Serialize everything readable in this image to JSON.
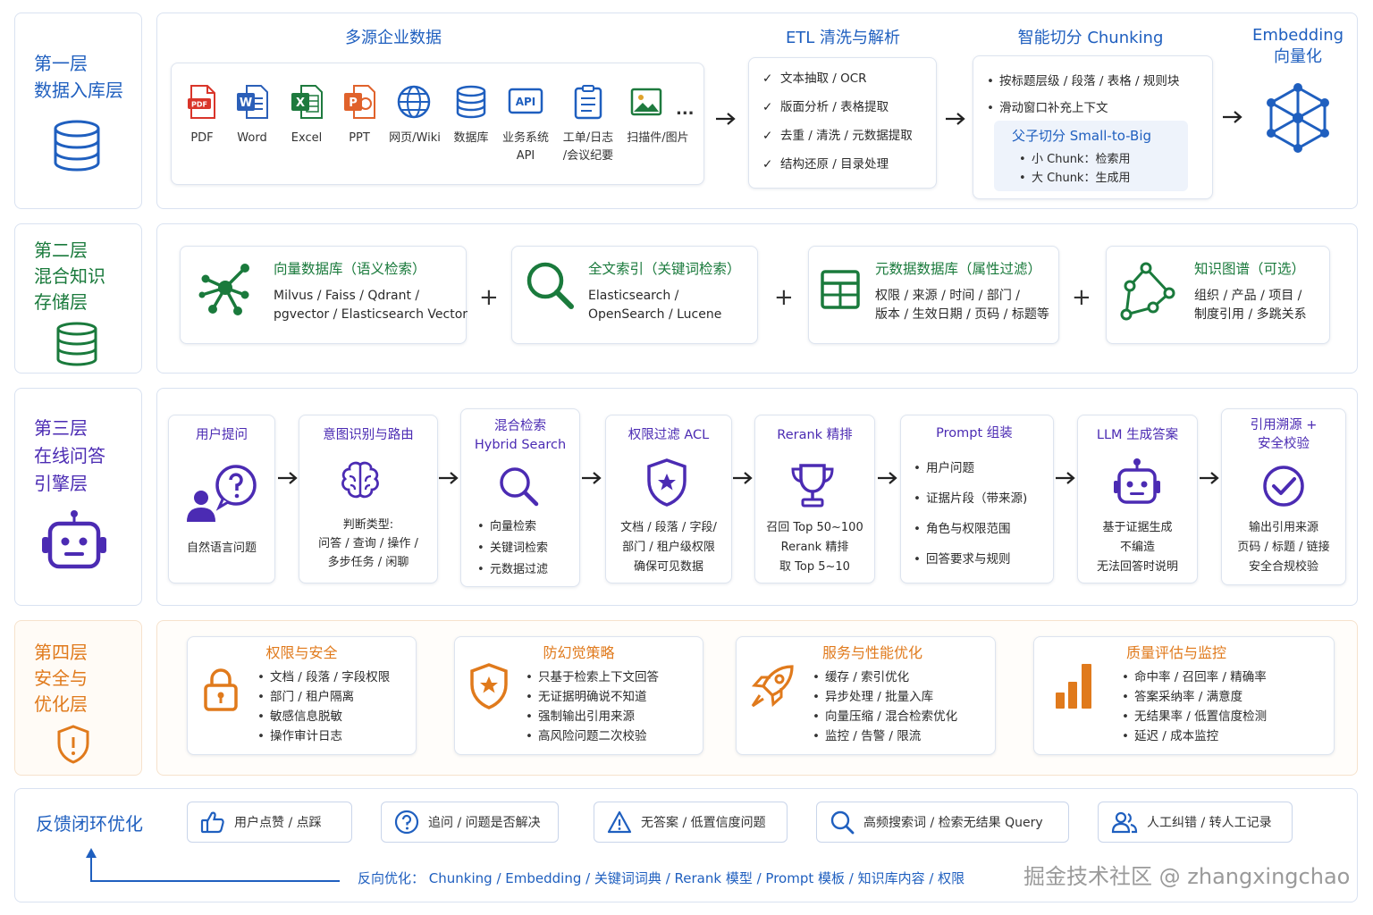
{
  "layer1": {
    "title_line1": "第一层",
    "title_line2": "数据入库层",
    "sources_header": "多源企业数据",
    "sources": [
      {
        "label": "PDF",
        "icon": "pdf-file-icon"
      },
      {
        "label": "Word",
        "icon": "word-file-icon"
      },
      {
        "label": "Excel",
        "icon": "excel-file-icon"
      },
      {
        "label": "PPT",
        "icon": "ppt-file-icon"
      },
      {
        "label": "网页/Wiki",
        "icon": "globe-icon"
      },
      {
        "label": "数据库",
        "icon": "database-icon"
      },
      {
        "label_line1": "业务系统",
        "label_line2": "API",
        "icon": "api-icon"
      },
      {
        "label_line1": "工单/日志",
        "label_line2": "/会议纪要",
        "icon": "clipboard-icon"
      },
      {
        "label": "扫描件/图片",
        "icon": "image-icon"
      }
    ],
    "ellipsis": "...",
    "etl_header": "ETL 清洗与解析",
    "etl_items": [
      "文本抽取 / OCR",
      "版面分析 / 表格提取",
      "去重 / 清洗 / 元数据提取",
      "结构还原 / 目录处理"
    ],
    "chunk_header": "智能切分 Chunking",
    "chunk_items": [
      "按标题层级 / 段落 / 表格 / 规则块",
      "滑动窗口补充上下文"
    ],
    "chunk_sub_header": "父子切分 Small-to-Big",
    "chunk_sub_items": [
      "小 Chunk：检索用",
      "大 Chunk：生成用"
    ],
    "embed_header_line1": "Embedding",
    "embed_header_line2": "向量化"
  },
  "layer2": {
    "title_line1": "第二层",
    "title_line2": "混合知识",
    "title_line3": "存储层",
    "stores": [
      {
        "title": "向量数据库（语义检索）",
        "line1": "Milvus / Faiss / Qdrant /",
        "line2": "pgvector / Elasticsearch Vector"
      },
      {
        "title": "全文索引（关键词检索）",
        "line1": "Elasticsearch /",
        "line2": "OpenSearch / Lucene"
      },
      {
        "title": "元数据数据库（属性过滤）",
        "line1": "权限 / 来源 / 时间 / 部门 /",
        "line2": "版本 / 生效日期 / 页码 / 标题等"
      },
      {
        "title": "知识图谱（可选）",
        "line1": "组织 / 产品 / 项目 /",
        "line2": "制度引用 / 多跳关系"
      }
    ],
    "plus": "+"
  },
  "layer3": {
    "title_line1": "第三层",
    "title_line2": "在线问答",
    "title_line3": "引擎层",
    "steps": [
      {
        "title": "用户提问",
        "body": [
          "自然语言问题"
        ]
      },
      {
        "title": "意图识别与路由",
        "body": [
          "判断类型:",
          "问答 / 查询 / 操作 /",
          "多步任务 / 闲聊"
        ]
      },
      {
        "title_line1": "混合检索",
        "title_line2": "Hybrid Search",
        "bullets": [
          "向量检索",
          "关键词检索",
          "元数据过滤"
        ]
      },
      {
        "title": "权限过滤 ACL",
        "body": [
          "文档 / 段落 / 字段/",
          "部门 / 租户级权限",
          "确保可见数据"
        ]
      },
      {
        "title": "Rerank 精排",
        "body": [
          "召回 Top 50~100",
          "Rerank 精排",
          "取 Top 5~10"
        ]
      },
      {
        "title": "Prompt 组装",
        "bullets": [
          "用户问题",
          "证据片段（带来源)",
          "角色与权限范围",
          "回答要求与规则"
        ]
      },
      {
        "title": "LLM 生成答案",
        "body": [
          "基于证据生成",
          "不编造",
          "无法回答时说明"
        ]
      },
      {
        "title_line1": "引用溯源 +",
        "title_line2": "安全校验",
        "body": [
          "输出引用来源",
          "页码 / 标题 / 链接",
          "安全合规校验"
        ]
      }
    ]
  },
  "layer4": {
    "title_line1": "第四层",
    "title_line2": "安全与",
    "title_line3": "优化层",
    "groups": [
      {
        "title": "权限与安全",
        "items": [
          "文档 / 段落 / 字段权限",
          "部门 / 租户隔离",
          "敏感信息脱敏",
          "操作审计日志"
        ]
      },
      {
        "title": "防幻觉策略",
        "items": [
          "只基于检索上下文回答",
          "无证据明确说不知道",
          "强制输出引用来源",
          "高风险问题二次校验"
        ]
      },
      {
        "title": "服务与性能优化",
        "items": [
          "缓存 / 索引优化",
          "异步处理 / 批量入库",
          "向量压缩 / 混合检索优化",
          "监控 / 告警 / 限流"
        ]
      },
      {
        "title": "质量评估与监控",
        "items": [
          "命中率 / 召回率 / 精确率",
          "答案采纳率 / 满意度",
          "无结果率 / 低置信度检测",
          "延迟 / 成本监控"
        ]
      }
    ]
  },
  "feedback": {
    "title": "反馈闭环优化",
    "chips": [
      "用户点赞 / 点踩",
      "追问 / 问题是否解决",
      "无答案 / 低置信度问题",
      "高频搜索词 / 检索无结果 Query",
      "人工纠错 / 转人工记录"
    ],
    "reverse_label": "反向优化：",
    "reverse_items": "Chunking / Embedding / 关键词词典 / Rerank 模型 / Prompt 模板 / 知识库内容 / 权限",
    "watermark": "掘金技术社区 @ zhangxingchao"
  },
  "colors": {
    "blue": "#1f5fbf",
    "green": "#1a7a3c",
    "purple": "#4b2bb3",
    "orange": "#e07a1c"
  }
}
